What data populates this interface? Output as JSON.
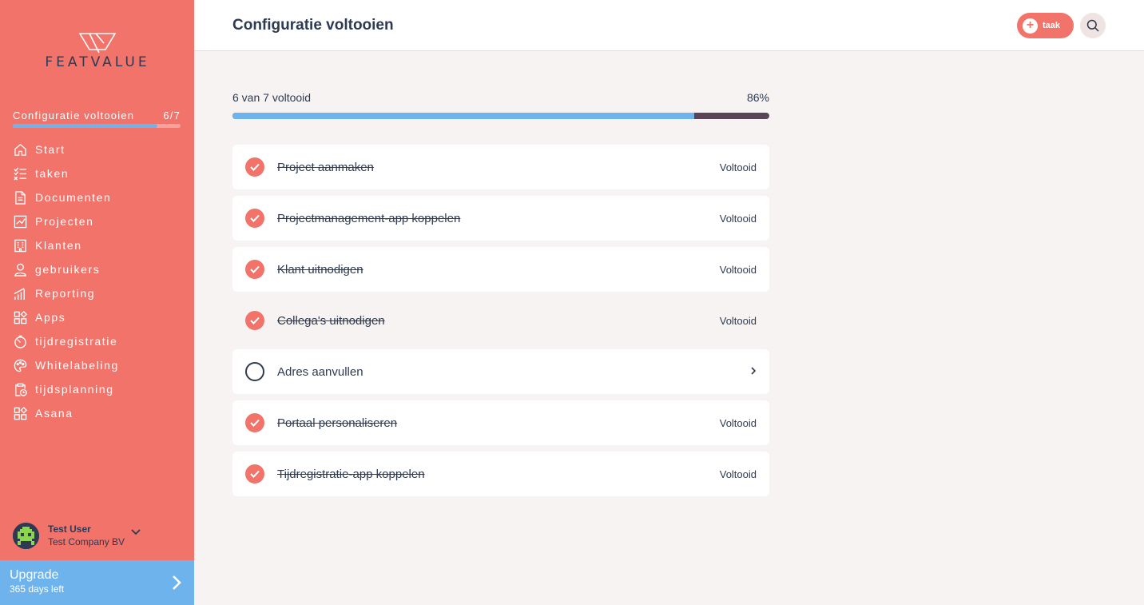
{
  "brand": {
    "name": "FEATVALUE"
  },
  "setup": {
    "label": "Configuratie voltooien",
    "count": "6/7",
    "progress": 0.86
  },
  "nav": [
    {
      "label": "Start",
      "icon": "home-icon"
    },
    {
      "label": "taken",
      "icon": "checklist-icon"
    },
    {
      "label": "Documenten",
      "icon": "document-icon"
    },
    {
      "label": "Projecten",
      "icon": "chart-icon"
    },
    {
      "label": "Klanten",
      "icon": "building-icon"
    },
    {
      "label": "gebruikers",
      "icon": "user-icon"
    },
    {
      "label": "Reporting",
      "icon": "bar-chart-icon"
    },
    {
      "label": "Apps",
      "icon": "apps-icon"
    },
    {
      "label": "tijdregistratie",
      "icon": "timer-icon"
    },
    {
      "label": "Whitelabeling",
      "icon": "palette-icon"
    },
    {
      "label": "tijdsplanning",
      "icon": "clipboard-clock-icon"
    },
    {
      "label": "Asana",
      "icon": "apps-icon"
    }
  ],
  "user": {
    "name": "Test User",
    "company": "Test Company BV"
  },
  "upgrade": {
    "title": "Upgrade",
    "subtitle": "365 days left"
  },
  "header": {
    "title": "Configuratie voltooien",
    "add_task_label": "taak"
  },
  "progress": {
    "label": "6 van 7 voltooid",
    "percent_text": "86%",
    "percent": 86
  },
  "tasks": [
    {
      "label": "Project aanmaken",
      "done": true,
      "status": "Voltooid"
    },
    {
      "label": "Projectmanagement-app koppelen",
      "done": true,
      "status": "Voltooid"
    },
    {
      "label": "Klant uitnodigen",
      "done": true,
      "status": "Voltooid"
    },
    {
      "label": "Collega's uitnodigen",
      "done": true,
      "status": "Voltooid"
    },
    {
      "label": "Adres aanvullen",
      "done": false,
      "status": ""
    },
    {
      "label": "Portaal personaliseren",
      "done": true,
      "status": "Voltooid"
    },
    {
      "label": "Tijdregistratie-app koppelen",
      "done": true,
      "status": "Voltooid"
    }
  ],
  "colors": {
    "accent": "#f2736a",
    "blue": "#6fb3ec",
    "navy": "#2d3a52",
    "bar_track": "#5a4558"
  }
}
